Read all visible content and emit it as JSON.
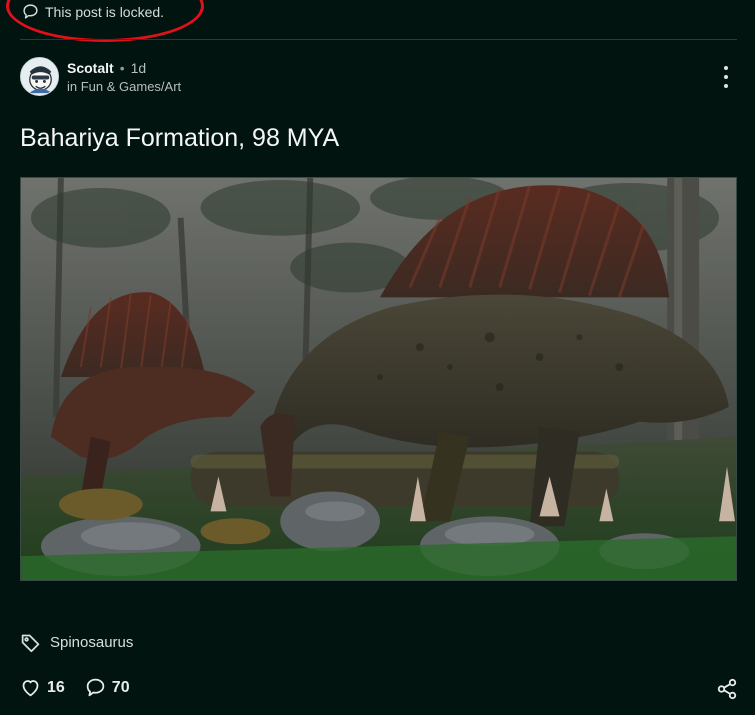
{
  "notice": {
    "text": "This post is locked.",
    "icon": "speech-bubble-icon",
    "highlight_color": "#e0111a"
  },
  "post": {
    "author": "Scotalt",
    "separator": "•",
    "age": "1d",
    "community": "in Fun & Games/Art",
    "title": "Bahariya Formation, 98 MYA",
    "image_alt": "Bahariya Formation, 98 MYA",
    "tag": "Spinosaurus",
    "likes": "16",
    "comments": "70"
  },
  "icons": {
    "locked": "speech-bubble-icon",
    "more": "kebab-menu-icon",
    "tag": "tag-icon",
    "like": "heart-icon",
    "comment": "comment-icon",
    "share": "share-icon"
  },
  "colors": {
    "background": "#021410",
    "text": "#e8ecea",
    "muted": "#b5bfbc"
  }
}
